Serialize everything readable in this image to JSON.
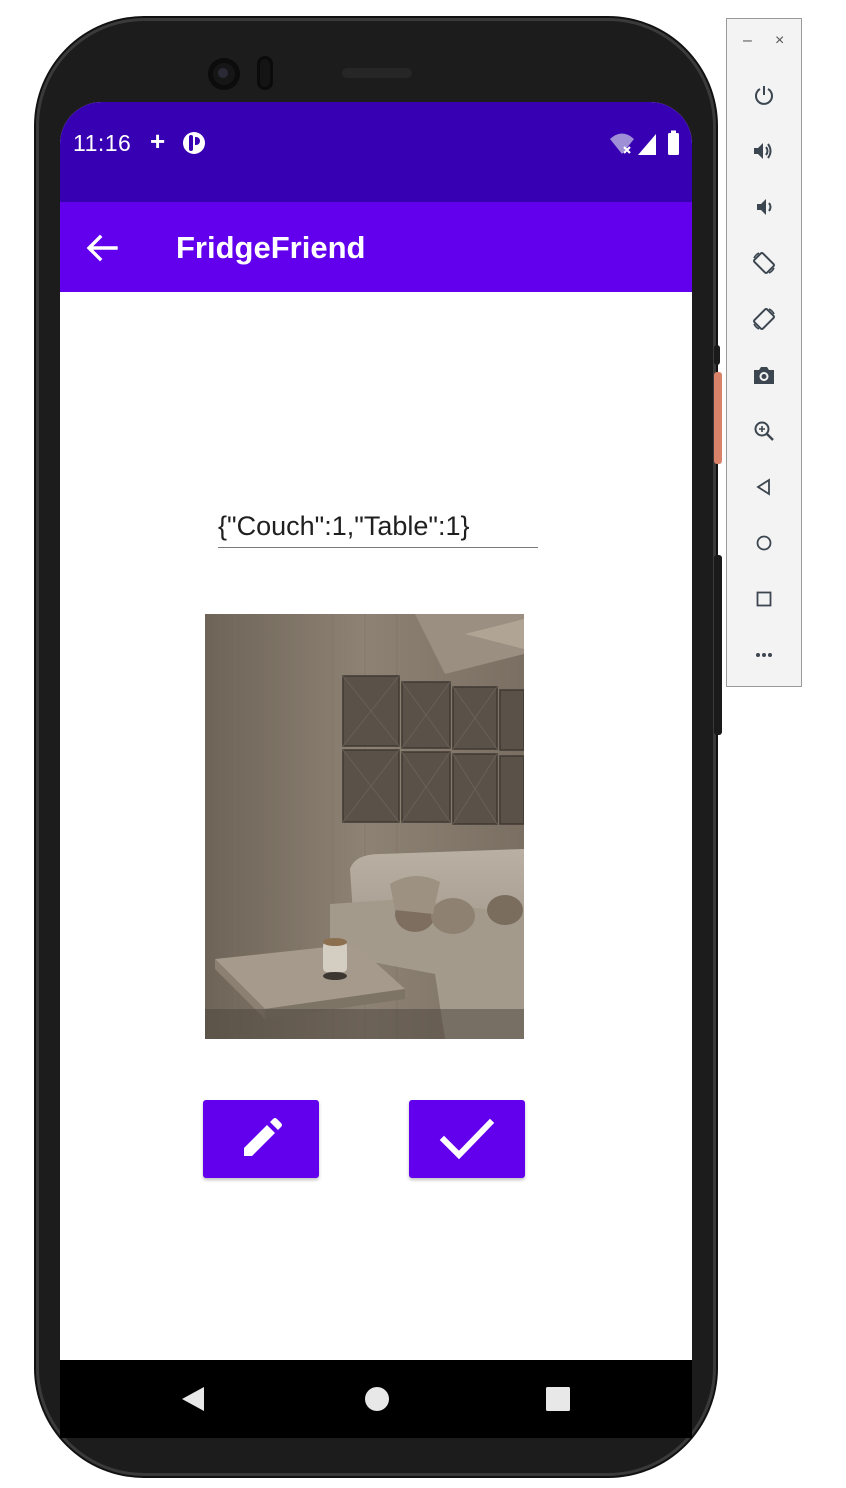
{
  "status_bar": {
    "time": "11:16",
    "plus_icon": "+",
    "app_indicator_icon": "circle-app-icon",
    "right_icons": [
      "wifi-off-icon",
      "signal-icon",
      "battery-icon"
    ]
  },
  "app_bar": {
    "title": "FridgeFriend",
    "back_icon": "arrow-left-icon"
  },
  "main": {
    "detection_text": "{\"Couch\":1,\"Table\":1}",
    "photo_alt": "living room with couch and table",
    "edit_button_icon": "pencil-icon",
    "confirm_button_icon": "checkmark-icon"
  },
  "nav_bar": {
    "items": [
      "back-triangle-icon",
      "home-circle-icon",
      "recents-square-icon"
    ]
  },
  "emulator_toolbar": {
    "minimize": "–",
    "close": "×",
    "tools": [
      "power-icon",
      "volume-up-icon",
      "volume-down-icon",
      "rotate-left-icon",
      "rotate-right-icon",
      "camera-icon",
      "zoom-icon",
      "back-icon",
      "home-icon",
      "overview-icon",
      "more-icon"
    ]
  },
  "colors": {
    "status_bar": "#3700b3",
    "primary": "#6200ee",
    "on_primary": "#ffffff"
  }
}
